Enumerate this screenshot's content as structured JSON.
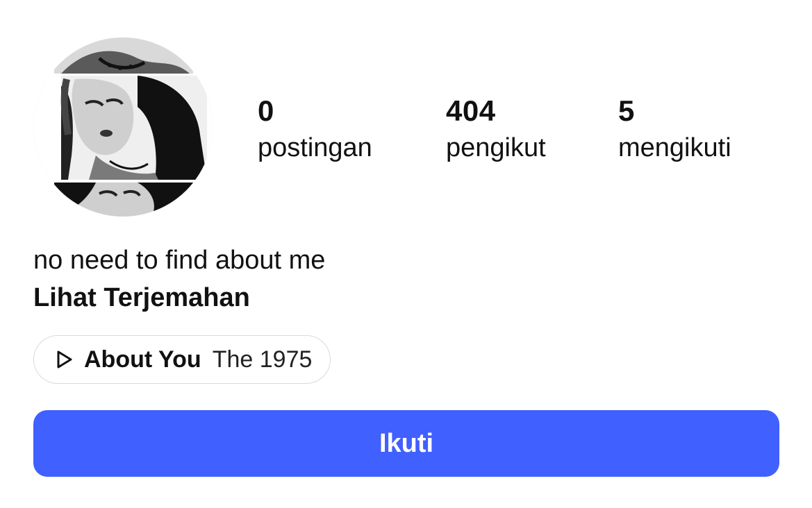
{
  "profile": {
    "avatar_alt": "profile-photo",
    "stats": [
      {
        "value": "0",
        "label": "postingan"
      },
      {
        "value": "404",
        "label": "pengikut"
      },
      {
        "value": "5",
        "label": "mengikuti"
      }
    ],
    "bio": "no need to find about me",
    "translate_label": "Lihat Terjemahan",
    "music": {
      "icon": "play-icon",
      "song": "About You",
      "artist": "The 1975"
    },
    "follow_label": "Ikuti"
  },
  "colors": {
    "accent": "#4060ff",
    "text": "#111111",
    "pill_border": "#d9d9d9",
    "background": "#ffffff"
  }
}
